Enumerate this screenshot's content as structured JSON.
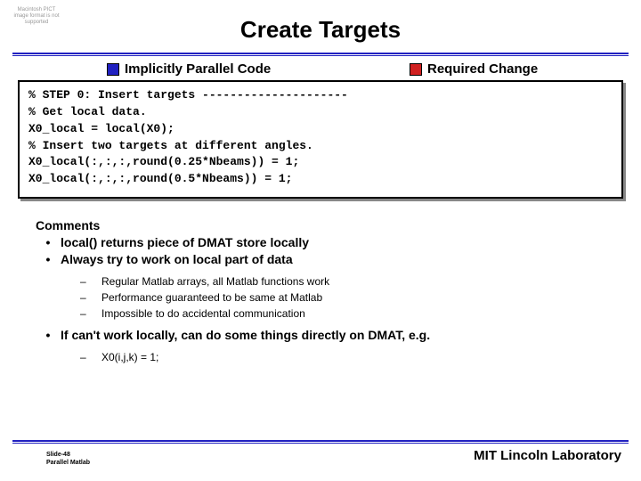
{
  "pict_placeholder": "Macintosh PICT image format is not supported",
  "title": "Create Targets",
  "legend": {
    "left": "Implicitly Parallel Code",
    "right": "Required Change"
  },
  "code": {
    "l1": "% STEP 0: Insert targets ---------------------",
    "l2": "",
    "l3": "% Get local data.",
    "l4": "X0_local = local(X0);",
    "l5": "",
    "l6": "% Insert two targets at different angles.",
    "l7": "X0_local(:,:,:,round(0.25*Nbeams)) = 1;",
    "l8": "X0_local(:,:,:,round(0.5*Nbeams)) = 1;"
  },
  "comments": {
    "heading": "Comments",
    "b1": "local() returns piece of DMAT store locally",
    "b2": "Always try to work on local part of data",
    "s1": "Regular Matlab arrays, all Matlab functions work",
    "s2": "Performance guaranteed to be same at Matlab",
    "s3": "Impossible to do accidental communication",
    "b3": "If can't work locally, can do some things directly on DMAT, e.g.",
    "s4": "X0(i,j,k) = 1;"
  },
  "footer": {
    "slide": "Slide-48",
    "sub": "Parallel Matlab",
    "lab": "MIT Lincoln Laboratory"
  }
}
